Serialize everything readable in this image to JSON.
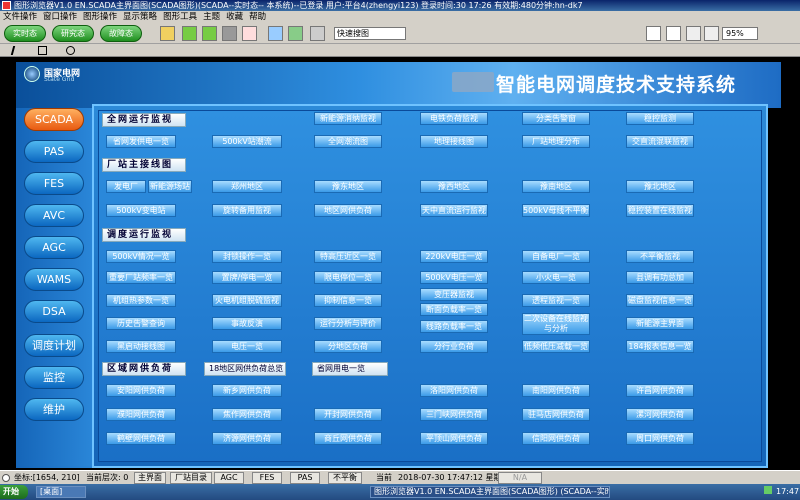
{
  "window": {
    "title": "图形浏览器V1.0 EN.SCADA主界面图(SCADA图形)(SCADA--实时态-- 本系统)--已登录  用户:平台4(zhengyi123)  登录时间:30 17:26  有效期:480分钟:hn-dk7"
  },
  "menu": [
    "文件操作",
    "窗口操作",
    "图形操作",
    "显示策略",
    "图形工具",
    "主题",
    "收藏",
    "帮助"
  ],
  "toolbar": {
    "btn1": "实时态",
    "btn2": "研究态",
    "btn3": "故障态",
    "search_placeholder": "快速搜图",
    "zoom": "95%"
  },
  "header": {
    "logo_cn": "国家电网",
    "logo_en": "State Grid",
    "system_title": "智能电网调度技术支持系统"
  },
  "nav": [
    "SCADA",
    "PAS",
    "FES",
    "AVC",
    "AGC",
    "WAMS",
    "DSA",
    "调度计划",
    "监控",
    "维护"
  ],
  "sections": {
    "s1": "全网运行监视",
    "s2": "厂站主接线图",
    "s3": "调度运行监视",
    "s4": "区域网供负荷",
    "s4b": "18地区网供负荷总览",
    "s4c": "省网用电一览"
  },
  "row1a": [
    "新能源消纳监视",
    "电铁负荷监视",
    "分类告警窗",
    "稳控监测"
  ],
  "row1b": [
    "省网发供电一览",
    "500kV站潮流",
    "全网潮流图",
    "地理接线图",
    "厂站地理分布",
    "交直流混联监视"
  ],
  "row2a": [
    "发电厂",
    "新能源场站",
    "郑州地区",
    "豫东地区",
    "豫西地区",
    "豫南地区",
    "豫北地区"
  ],
  "row2b": [
    "500kV变电站",
    "旋转备用监视",
    "地区网供负荷",
    "天中直流运行监视",
    "500kV母线不平衡量",
    "稳控装置在线监视"
  ],
  "ops_col1": [
    "500kV情况一览",
    "重要厂站频率一览",
    "机组热参数一览",
    "历史告警查询",
    "黑启动接线图"
  ],
  "ops_col2": [
    "封锁操作一览",
    "置牌/停电一览",
    "火电机组脱硫监视",
    "事故反演",
    "电压一览"
  ],
  "ops_col3": [
    "特高压近区一览",
    "限电停位一览",
    "抑制信息一览",
    "运行分析与评价",
    "分地区负荷"
  ],
  "ops_col4": [
    "220kV电压一览",
    "500kV电压一览",
    "变压器监视",
    "断面负载率一览",
    "线路负载率一览",
    "分行业负荷"
  ],
  "ops_col5": [
    "自备电厂一览",
    "小火电一览",
    "透程监视一览",
    "二次设备在线监视与分析",
    "低频低压减载一览"
  ],
  "ops_col6": [
    "不平衡监视",
    "县调有功总加",
    "磁盘监视信息一览",
    "新能源主界面",
    "184报表信息一览"
  ],
  "region_rows": [
    [
      "安阳网供负荷",
      "新乡网供负荷",
      "省网用电一览",
      "洛阳网供负荷",
      "南阳网供负荷",
      "许昌网供负荷"
    ],
    [
      "濮阳网供负荷",
      "焦作网供负荷",
      "开封网供负荷",
      "三门峡网供负荷",
      "驻马店网供负荷",
      "漯河网供负荷"
    ],
    [
      "鹤壁网供负荷",
      "济源网供负荷",
      "商丘网供负荷",
      "平顶山网供负荷",
      "信阳网供负荷",
      "周口网供负荷"
    ]
  ],
  "status": {
    "coord": "坐标:[1654, 210]",
    "layer_label": "当前层次: 0",
    "main": "主界面",
    "station_dir": "厂站目录",
    "agc": "AGC",
    "fes": "FES",
    "pas": "PAS",
    "unbalance": "不平衡",
    "current": "当前",
    "datetime": "2018-07-30 17:47:12 星期一",
    "na": "N/A"
  },
  "taskbar": {
    "start": "开始",
    "task1": "[桌面]",
    "task2": "图形浏览器V1.0 EN.SCADA主界面图(SCADA图形) (SCADA--实时态-- 本系统)",
    "clock": "17:47"
  }
}
